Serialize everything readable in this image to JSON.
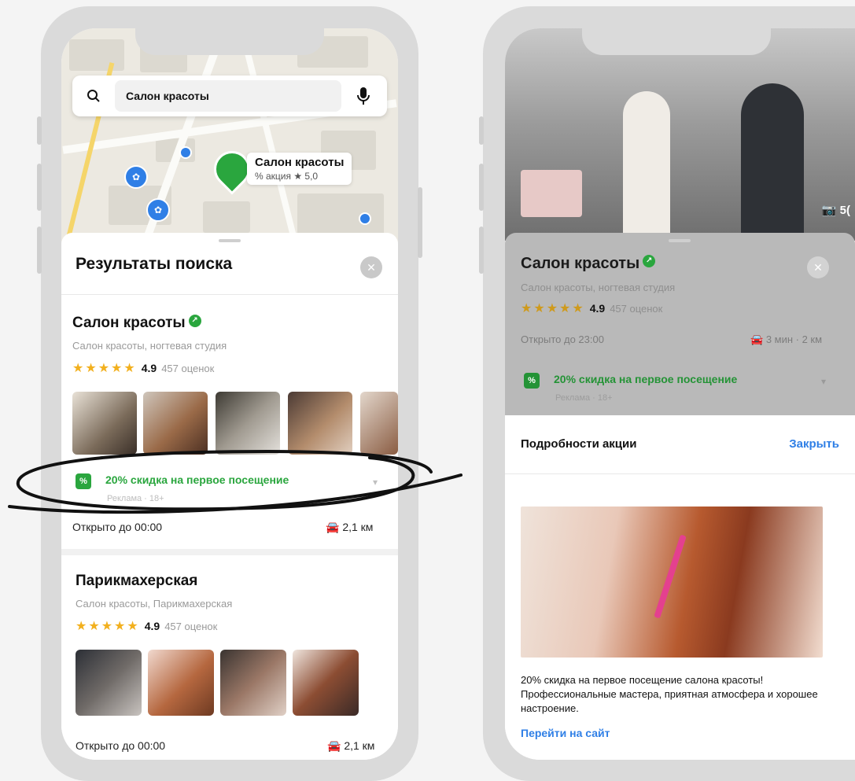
{
  "left_screen": {
    "search": {
      "value": "Салон красоты"
    },
    "map_pin": {
      "title": "Салон красоты",
      "subtitle": "% акция  ★ 5,0"
    },
    "sheet_title": "Результаты поиска",
    "results": [
      {
        "name": "Салон красоты",
        "category": "Салон красоты, ногтевая студия",
        "rating": "4.9",
        "reviews": "457 оценок",
        "promo": {
          "text": "20% скидка на первое посещение",
          "sub": "Реклама · 18+"
        },
        "open": "Открыто до 00:00",
        "distance": "2,1 км"
      },
      {
        "name": "Парикмахерская",
        "category": "Салон красоты, Парикмахерская",
        "rating": "4.9",
        "reviews": "457 оценок",
        "open": "Открыто до 00:00",
        "distance": "2,1 км"
      }
    ]
  },
  "right_screen": {
    "photo_count": "5(",
    "org": {
      "name": "Салон красоты",
      "category": "Салон красоты, ногтевая студия",
      "rating": "4.9",
      "reviews": "457 оценок",
      "open": "Открыто до 23:00",
      "drive": "3 мин · 2 км",
      "promo": {
        "text": "20% скидка на первое посещение",
        "sub": "Реклама · 18+"
      }
    },
    "details": {
      "title": "Подробности акции",
      "close": "Закрыть",
      "description": "20% скидка на первое посещение салона красоты! Профессиональные мастера, приятная атмосфера и хорошее настроение.",
      "link": "Перейти на сайт"
    }
  },
  "colors": {
    "accent_green": "#2aa63e",
    "link_blue": "#2f7fe6",
    "star_yellow": "#f2b01e"
  }
}
